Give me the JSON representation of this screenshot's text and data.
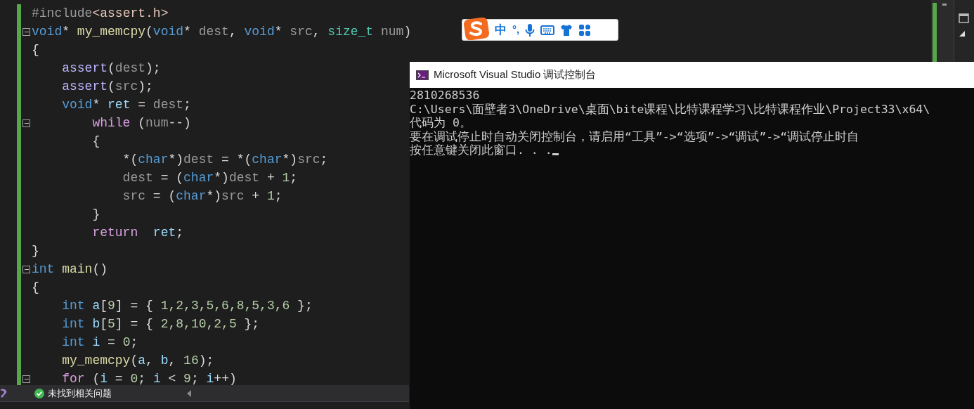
{
  "editor": {
    "lines": [
      {
        "tokens": [
          {
            "text": "#include",
            "kind": "preproc"
          },
          {
            "text": "<assert.h>",
            "kind": "string"
          }
        ]
      },
      {
        "expanded": true,
        "tokens": [
          {
            "text": "void",
            "kind": "keyword"
          },
          {
            "text": "* ",
            "kind": "plain"
          },
          {
            "text": "my_memcpy",
            "kind": "func"
          },
          {
            "text": "(",
            "kind": "plain"
          },
          {
            "text": "void",
            "kind": "keyword"
          },
          {
            "text": "* ",
            "kind": "plain"
          },
          {
            "text": "dest",
            "kind": "param"
          },
          {
            "text": ", ",
            "kind": "plain"
          },
          {
            "text": "void",
            "kind": "keyword"
          },
          {
            "text": "* ",
            "kind": "plain"
          },
          {
            "text": "src",
            "kind": "param"
          },
          {
            "text": ", ",
            "kind": "plain"
          },
          {
            "text": "size_t",
            "kind": "type"
          },
          {
            "text": " num",
            "kind": "param"
          },
          {
            "text": ")",
            "kind": "plain"
          }
        ]
      },
      {
        "tokens": [
          {
            "text": "{",
            "kind": "plain"
          }
        ]
      },
      {
        "tokens": [
          {
            "text": "    assert",
            "kind": "macro"
          },
          {
            "text": "(",
            "kind": "plain"
          },
          {
            "text": "dest",
            "kind": "param"
          },
          {
            "text": ");",
            "kind": "plain"
          }
        ]
      },
      {
        "tokens": [
          {
            "text": "    assert",
            "kind": "macro"
          },
          {
            "text": "(",
            "kind": "plain"
          },
          {
            "text": "src",
            "kind": "param"
          },
          {
            "text": ");",
            "kind": "plain"
          }
        ]
      },
      {
        "tokens": [
          {
            "text": "    void",
            "kind": "keyword"
          },
          {
            "text": "* ",
            "kind": "plain"
          },
          {
            "text": "ret",
            "kind": "var"
          },
          {
            "text": " = ",
            "kind": "plain"
          },
          {
            "text": "dest",
            "kind": "param"
          },
          {
            "text": ";",
            "kind": "plain"
          }
        ]
      },
      {
        "expanded": true,
        "tokens": [
          {
            "text": "        while",
            "kind": "control"
          },
          {
            "text": " (",
            "kind": "plain"
          },
          {
            "text": "num",
            "kind": "param"
          },
          {
            "text": "--)",
            "kind": "plain"
          }
        ]
      },
      {
        "tokens": [
          {
            "text": "        {",
            "kind": "plain"
          }
        ]
      },
      {
        "tokens": [
          {
            "text": "            *(",
            "kind": "plain"
          },
          {
            "text": "char",
            "kind": "keyword"
          },
          {
            "text": "*)",
            "kind": "plain"
          },
          {
            "text": "dest",
            "kind": "param"
          },
          {
            "text": " = *(",
            "kind": "plain"
          },
          {
            "text": "char",
            "kind": "keyword"
          },
          {
            "text": "*)",
            "kind": "plain"
          },
          {
            "text": "src",
            "kind": "param"
          },
          {
            "text": ";",
            "kind": "plain"
          }
        ]
      },
      {
        "tokens": [
          {
            "text": "            dest",
            "kind": "param"
          },
          {
            "text": " = (",
            "kind": "plain"
          },
          {
            "text": "char",
            "kind": "keyword"
          },
          {
            "text": "*)",
            "kind": "plain"
          },
          {
            "text": "dest",
            "kind": "param"
          },
          {
            "text": " + ",
            "kind": "plain"
          },
          {
            "text": "1",
            "kind": "number"
          },
          {
            "text": ";",
            "kind": "plain"
          }
        ]
      },
      {
        "tokens": [
          {
            "text": "            src",
            "kind": "param"
          },
          {
            "text": " = (",
            "kind": "plain"
          },
          {
            "text": "char",
            "kind": "keyword"
          },
          {
            "text": "*)",
            "kind": "plain"
          },
          {
            "text": "src",
            "kind": "param"
          },
          {
            "text": " + ",
            "kind": "plain"
          },
          {
            "text": "1",
            "kind": "number"
          },
          {
            "text": ";",
            "kind": "plain"
          }
        ]
      },
      {
        "tokens": [
          {
            "text": "        }",
            "kind": "plain"
          }
        ]
      },
      {
        "tokens": [
          {
            "text": "        return",
            "kind": "control"
          },
          {
            "text": "  ret",
            "kind": "var"
          },
          {
            "text": ";",
            "kind": "plain"
          }
        ]
      },
      {
        "tokens": [
          {
            "text": "}",
            "kind": "plain"
          }
        ]
      },
      {
        "expanded": true,
        "tokens": [
          {
            "text": "int",
            "kind": "keyword"
          },
          {
            "text": " main",
            "kind": "func"
          },
          {
            "text": "()",
            "kind": "plain"
          }
        ]
      },
      {
        "tokens": [
          {
            "text": "{",
            "kind": "plain"
          }
        ]
      },
      {
        "tokens": [
          {
            "text": "    int",
            "kind": "keyword"
          },
          {
            "text": " a",
            "kind": "var"
          },
          {
            "text": "[",
            "kind": "plain"
          },
          {
            "text": "9",
            "kind": "number"
          },
          {
            "text": "] = { ",
            "kind": "plain"
          },
          {
            "text": "1,2,3,5,6,8,5,3,6",
            "kind": "number"
          },
          {
            "text": " };",
            "kind": "plain"
          }
        ]
      },
      {
        "tokens": [
          {
            "text": "    int",
            "kind": "keyword"
          },
          {
            "text": " b",
            "kind": "var"
          },
          {
            "text": "[",
            "kind": "plain"
          },
          {
            "text": "5",
            "kind": "number"
          },
          {
            "text": "] = { ",
            "kind": "plain"
          },
          {
            "text": "2,8,10,2,5",
            "kind": "number"
          },
          {
            "text": " };",
            "kind": "plain"
          }
        ]
      },
      {
        "tokens": [
          {
            "text": "    int",
            "kind": "keyword"
          },
          {
            "text": " i",
            "kind": "var"
          },
          {
            "text": " = ",
            "kind": "plain"
          },
          {
            "text": "0",
            "kind": "number"
          },
          {
            "text": ";",
            "kind": "plain"
          }
        ]
      },
      {
        "tokens": [
          {
            "text": "    my_memcpy",
            "kind": "func"
          },
          {
            "text": "(",
            "kind": "plain"
          },
          {
            "text": "a",
            "kind": "var"
          },
          {
            "text": ", ",
            "kind": "plain"
          },
          {
            "text": "b",
            "kind": "var"
          },
          {
            "text": ", ",
            "kind": "plain"
          },
          {
            "text": "16",
            "kind": "number"
          },
          {
            "text": ");",
            "kind": "plain"
          }
        ]
      },
      {
        "expanded": true,
        "tokens": [
          {
            "text": "    for",
            "kind": "control"
          },
          {
            "text": " (",
            "kind": "plain"
          },
          {
            "text": "i",
            "kind": "var"
          },
          {
            "text": " = ",
            "kind": "plain"
          },
          {
            "text": "0",
            "kind": "number"
          },
          {
            "text": "; ",
            "kind": "plain"
          },
          {
            "text": "i",
            "kind": "var"
          },
          {
            "text": " < ",
            "kind": "plain"
          },
          {
            "text": "9",
            "kind": "number"
          },
          {
            "text": "; ",
            "kind": "plain"
          },
          {
            "text": "i",
            "kind": "var"
          },
          {
            "text": "++)",
            "kind": "plain"
          }
        ]
      }
    ]
  },
  "ime_toolbar": {
    "language": "中",
    "punctuation": "°,"
  },
  "status_bar": {
    "message": "未找到相关问题"
  },
  "console": {
    "title": "Microsoft Visual Studio 调试控制台",
    "lines": [
      "2810268536",
      "C:\\Users\\面壁者3\\OneDrive\\桌面\\bite课程\\比特课程学习\\比特课程作业\\Project33\\x64\\",
      "代码为 0。",
      "要在调试停止时自动关闭控制台，请启用“工具”->“选项”->“调试”->“调试停止时自",
      "按任意键关闭此窗口. . ."
    ]
  }
}
